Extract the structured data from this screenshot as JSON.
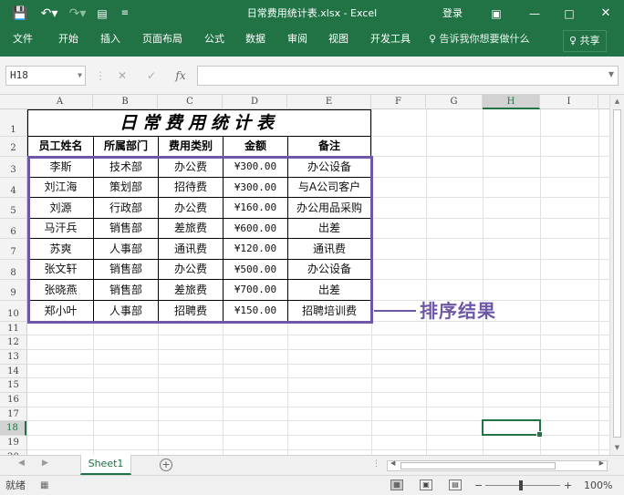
{
  "titlebar": {
    "save_icon": "save-icon",
    "undo_icon": "undo-icon",
    "redo_icon": "redo-icon",
    "form_icon": "form-icon",
    "customize_icon": "customize-qat-icon",
    "title": "日常费用统计表.xlsx  -  Excel",
    "login": "登录",
    "ribbon_display_icon": "ribbon-display-icon",
    "minimize_icon": "minimize-icon",
    "maximize_icon": "maximize-icon",
    "close_icon": "close-icon"
  },
  "ribbon": {
    "tabs": [
      "文件",
      "开始",
      "插入",
      "页面布局",
      "公式",
      "数据",
      "审阅",
      "视图",
      "开发工具"
    ],
    "tell_me": "♀ 告诉我你想要做什么",
    "share": "♀ 共享"
  },
  "formula_bar": {
    "name_box": "H18",
    "cancel": "✕",
    "enter": "✓",
    "fx": "fx",
    "formula_value": ""
  },
  "columns": [
    "A",
    "B",
    "C",
    "D",
    "E",
    "F",
    "G",
    "H",
    "I"
  ],
  "rows": [
    "1",
    "2",
    "3",
    "4",
    "5",
    "6",
    "7",
    "8",
    "9",
    "10",
    "11",
    "12",
    "13",
    "14",
    "15",
    "16",
    "17",
    "18",
    "19",
    "20"
  ],
  "sheet_table": {
    "title": "日常费用统计表",
    "headers": [
      "员工姓名",
      "所属部门",
      "费用类别",
      "金额",
      "备注"
    ],
    "rows": [
      [
        "李斯",
        "技术部",
        "办公费",
        "¥300.00",
        "办公设备"
      ],
      [
        "刘江海",
        "策划部",
        "招待费",
        "¥300.00",
        "与A公司客户"
      ],
      [
        "刘源",
        "行政部",
        "办公费",
        "¥160.00",
        "办公用品采购"
      ],
      [
        "马汗兵",
        "销售部",
        "差旅费",
        "¥600.00",
        "出差"
      ],
      [
        "苏爽",
        "人事部",
        "通讯费",
        "¥120.00",
        "通讯费"
      ],
      [
        "张文轩",
        "销售部",
        "办公费",
        "¥500.00",
        "办公设备"
      ],
      [
        "张晓燕",
        "销售部",
        "差旅费",
        "¥700.00",
        "出差"
      ],
      [
        "郑小叶",
        "人事部",
        "招聘费",
        "¥150.00",
        "招聘培训费"
      ]
    ]
  },
  "annotation": "排序结果",
  "sheet_tabs": {
    "active": "Sheet1",
    "add": "+"
  },
  "status": {
    "mode": "就绪",
    "zoom": "100%",
    "minus": "−",
    "plus": "+"
  },
  "colors": {
    "excel_green": "#217346",
    "annotation_purple": "#6d57a6"
  }
}
